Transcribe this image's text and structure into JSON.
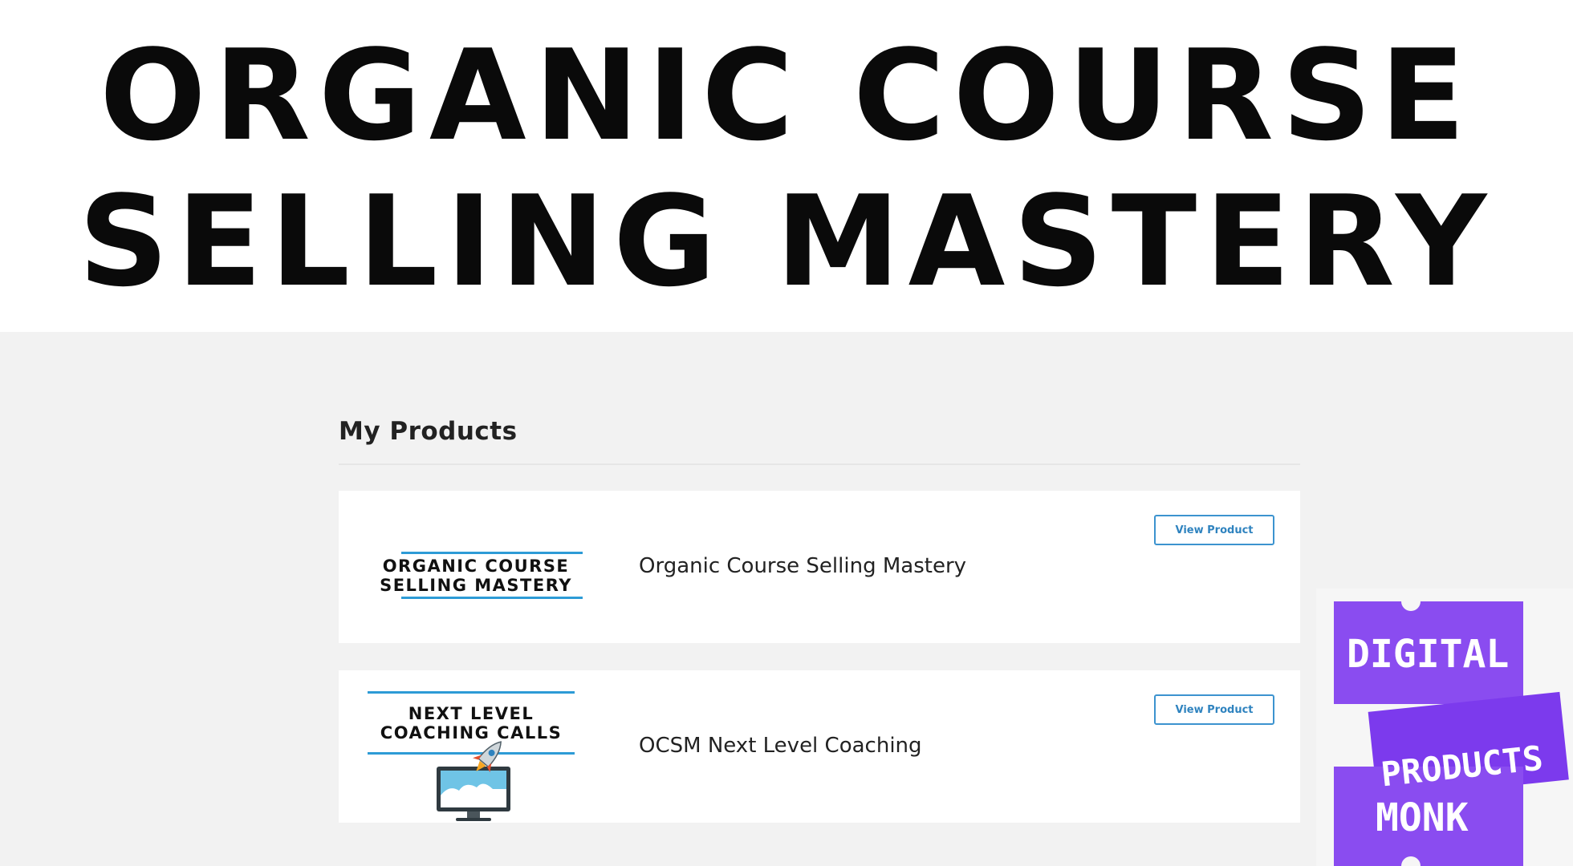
{
  "hero": {
    "title_line1": "ORGANIC COURSE",
    "title_line2": "SELLING MASTERY"
  },
  "products_section": {
    "heading": "My Products",
    "items": [
      {
        "thumbnail_text_line1": "ORGANIC COURSE",
        "thumbnail_text_line2": "SELLING MASTERY",
        "name": "Organic Course Selling Mastery",
        "button_label": "View Product"
      },
      {
        "thumbnail_text_line1": "NEXT LEVEL",
        "thumbnail_text_line2": "COACHING CALLS",
        "thumbnail_icon": "rocket-monitor-icon",
        "name": "OCSM Next Level Coaching",
        "button_label": "View Product"
      }
    ]
  },
  "watermark": {
    "line1": "DIGITAL",
    "line2": "PRODUCTS",
    "line3": "MONK"
  },
  "colors": {
    "accent_blue": "#3c93cf",
    "watermark_purple": "#8a4cf0",
    "page_background": "#f2f2f2"
  }
}
